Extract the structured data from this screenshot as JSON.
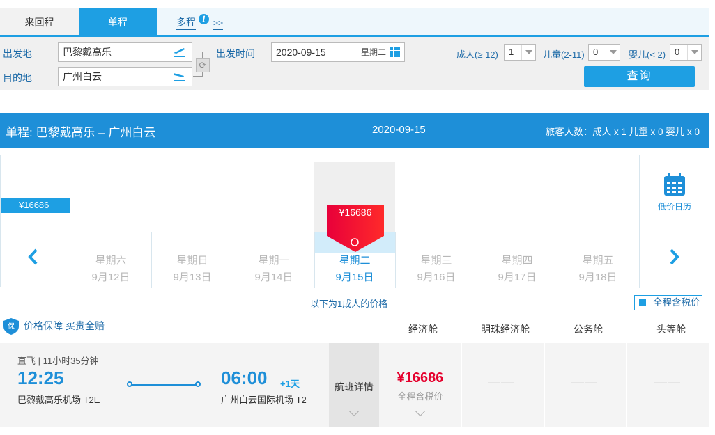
{
  "tabs": {
    "roundtrip": "来回程",
    "oneway": "单程",
    "multi": "多程",
    "multi_arrows": ">>",
    "info": "i"
  },
  "search": {
    "origin_label": "出发地",
    "origin_value": "巴黎戴高乐",
    "dest_label": "目的地",
    "dest_value": "广州白云",
    "depart_label": "出发时间",
    "depart_date": "2020-09-15",
    "depart_weekday": "星期二",
    "adult_label": "成人(≥ 12)",
    "adult_value": "1",
    "child_label": "儿童(2-11)",
    "child_value": "0",
    "infant_label": "婴儿(< 2)",
    "infant_value": "0",
    "query_button": "查询"
  },
  "result_header": {
    "route": "单程:  巴黎戴高乐  –  广州白云",
    "date": "2020-09-15",
    "pax": "旅客人数：成人 x 1   儿童 x 0   婴儿 x 0"
  },
  "price_chart": {
    "axis_price": "¥16686",
    "selected_price": "¥16686",
    "low_price_calendar": "低价日历",
    "days": [
      {
        "weekday": "星期六",
        "date": "9月12日"
      },
      {
        "weekday": "星期日",
        "date": "9月13日"
      },
      {
        "weekday": "星期一",
        "date": "9月14日"
      },
      {
        "weekday": "星期二",
        "date": "9月15日"
      },
      {
        "weekday": "星期三",
        "date": "9月16日"
      },
      {
        "weekday": "星期四",
        "date": "9月17日"
      },
      {
        "weekday": "星期五",
        "date": "9月18日"
      }
    ]
  },
  "price_note": "以下为1成人的价格",
  "tax_toggle": "全程含税价",
  "guarantee": "价格保障 买贵全赔",
  "cabins": {
    "economy": "经济舱",
    "pearl_economy": "明珠经济舱",
    "business": "公务舱",
    "first": "头等舱"
  },
  "flight": {
    "meta": "直飞 | 11小时35分钟",
    "depart_time": "12:25",
    "depart_airport": "巴黎戴高乐机场 T2E",
    "arrive_time": "06:00",
    "next_day": "+1天",
    "arrive_airport": "广州白云国际机场 T2",
    "detail_label": "航班详情",
    "economy_price": "¥16686",
    "economy_sub": "全程含税价",
    "pearl_economy": "——",
    "business": "——",
    "first": "——"
  },
  "colors": {
    "brand": "#1e9fe3",
    "header": "#1e8fd8",
    "price_red": "#e5002d"
  }
}
